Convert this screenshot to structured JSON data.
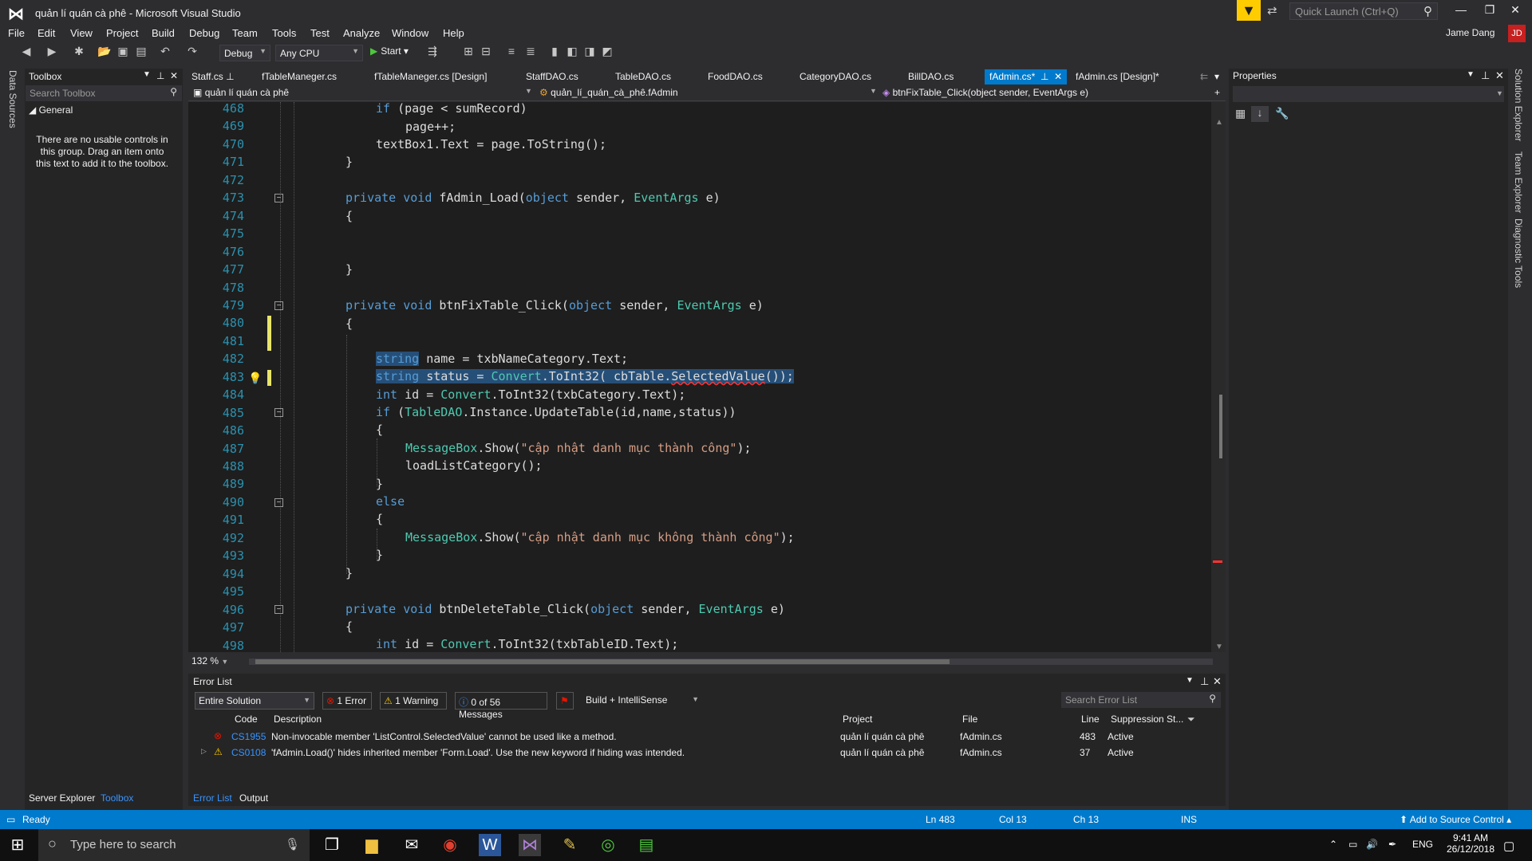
{
  "window": {
    "title": "quản lí quán cà phê - Microsoft Visual Studio",
    "quick_launch": "Quick Launch (Ctrl+Q)"
  },
  "menu": [
    "File",
    "Edit",
    "View",
    "Project",
    "Build",
    "Debug",
    "Team",
    "Tools",
    "Test",
    "Analyze",
    "Window",
    "Help"
  ],
  "user": {
    "name": "Jame Dang",
    "initials": "JD"
  },
  "toolbar": {
    "config": "Debug",
    "platform": "Any CPU",
    "start": "Start"
  },
  "left_strip": {
    "label": "Data Sources"
  },
  "toolbox": {
    "title": "Toolbox",
    "search": "Search Toolbox",
    "group": "General",
    "message": "There are no usable controls in this group. Drag an item onto this text to add it to the toolbox.",
    "tabs": [
      "Server Explorer",
      "Toolbox"
    ]
  },
  "tabs": [
    "Staff.cs",
    "fTableManeger.cs",
    "fTableManeger.cs [Design]",
    "StaffDAO.cs",
    "TableDAO.cs",
    "FoodDAO.cs",
    "CategoryDAO.cs",
    "BillDAO.cs",
    "fAdmin.cs*",
    "fAdmin.cs [Design]*"
  ],
  "nav": {
    "project": "quản lí quán cà phê",
    "class": "quản_lí_quán_cà_phê.fAdmin",
    "member": "btnFixTable_Click(object sender, EventArgs e)"
  },
  "editor": {
    "zoom": "132 %",
    "lines": [
      468,
      469,
      470,
      471,
      472,
      473,
      474,
      475,
      476,
      477,
      478,
      479,
      480,
      481,
      482,
      483,
      484,
      485,
      486,
      487,
      488,
      489,
      490,
      491,
      492,
      493,
      494,
      495,
      496,
      497,
      498
    ],
    "code": {
      "l468": "if (page < sumRecord)",
      "l469": "page++;",
      "l470": "textBox1.Text = page.ToString();",
      "l471": "}",
      "l473a": "private",
      "l473b": "void",
      "l473c": "fAdmin_Load(",
      "l473d": "object",
      "l473e": "sender,",
      "l473f": "EventArgs",
      "l473g": "e)",
      "l479c": "btnFixTable_Click(",
      "l482a": "string",
      "l482b": " name = txbNameCategory.Text;",
      "l483a": "string",
      "l483b": " status = ",
      "l483c": "Convert",
      "l483d": ".ToInt32( cbTable.",
      "l483e": "SelectedValue",
      "l483f": "());",
      "l484a": "int",
      "l484b": " id = ",
      "l484c": "Convert",
      "l484d": ".ToInt32(txbCategory.Text);",
      "l485a": "if",
      "l485b": " (",
      "l485c": "TableDAO",
      "l485d": ".Instance.UpdateTable(id,name,status))",
      "l487a": "MessageBox",
      "l487b": ".Show(",
      "l487c": "\"cập nhật danh mục thành công\"",
      "l487d": ");",
      "l488": "loadListCategory();",
      "l490": "else",
      "l492c": "\"cập nhật danh mục không thành công\"",
      "l496c": "btnDeleteTable_Click(",
      "l498d": ".ToInt32(txbTableID.Text);",
      "open": "{",
      "close": "}"
    }
  },
  "properties": {
    "title": "Properties"
  },
  "right_strip": [
    "Solution Explorer",
    "Team Explorer",
    "Diagnostic Tools"
  ],
  "error_list": {
    "title": "Error List",
    "scope": "Entire Solution",
    "errors_btn": "1 Error",
    "warnings_btn": "1 Warning",
    "messages_btn": "0 of 56 Messages",
    "build_filter": "Build + IntelliSense",
    "search": "Search Error List",
    "headers": [
      "Code",
      "Description",
      "Project",
      "File",
      "Line",
      "Suppression St..."
    ],
    "rows": [
      {
        "code": "CS1955",
        "desc": "Non-invocable member 'ListControl.SelectedValue' cannot be used like a method.",
        "project": "quản lí quán cà phê",
        "file": "fAdmin.cs",
        "line": "483",
        "state": "Active"
      },
      {
        "code": "CS0108",
        "desc": "'fAdmin.Load()' hides inherited member 'Form.Load'. Use the new keyword if hiding was intended.",
        "project": "quản lí quán cà phê",
        "file": "fAdmin.cs",
        "line": "37",
        "state": "Active"
      }
    ],
    "tabs": [
      "Error List",
      "Output"
    ]
  },
  "status": {
    "ready": "Ready",
    "ln": "Ln 483",
    "col": "Col 13",
    "ch": "Ch 13",
    "ins": "INS",
    "source": "Add to Source Control"
  },
  "taskbar": {
    "search": "Type here to search",
    "lang": "ENG",
    "time": "9:41 AM",
    "date": "26/12/2018"
  },
  "colors": {
    "accent": "#007acc",
    "keyword": "#569cd6",
    "type": "#4ec9b0",
    "string": "#d69d85",
    "linenum": "#2b91af"
  }
}
